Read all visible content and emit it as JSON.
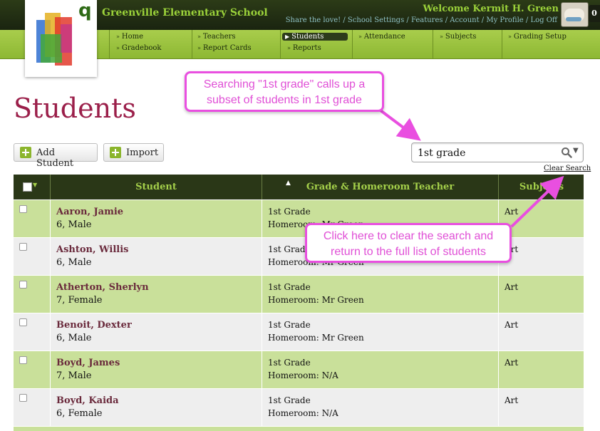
{
  "app": {
    "school_name": "Greenville Elementary School",
    "welcome": "Welcome Kermit H. Green",
    "avatar_badge": "0",
    "top_links": [
      "Share the love!",
      "School Settings",
      "Features",
      "Account",
      "My Profile",
      "Log Off"
    ],
    "logo_letter": "q"
  },
  "nav": {
    "col1": [
      "Home",
      "Gradebook"
    ],
    "col2": [
      "Teachers",
      "Report Cards"
    ],
    "col3": [
      "Students",
      "Reports"
    ],
    "col4": [
      "Attendance"
    ],
    "col5": [
      "Subjects"
    ],
    "col6": [
      "Grading Setup"
    ],
    "active": "Students"
  },
  "page": {
    "title": "Students",
    "add_student_label": "Add Student",
    "import_label": "Import",
    "search_value": "1st grade",
    "clear_search_label": "Clear Search"
  },
  "table": {
    "headers": [
      "Student",
      "Grade & Homeroom Teacher",
      "Subjects"
    ],
    "rows": [
      {
        "name": "Aaron, Jamie",
        "info": "6, Male",
        "grade": "1st Grade",
        "homeroom": "Homeroom: Mr Green",
        "subjects": "Art"
      },
      {
        "name": "Ashton, Willis",
        "info": "6, Male",
        "grade": "1st Grade",
        "homeroom": "Homeroom: Mr Green",
        "subjects": "Art"
      },
      {
        "name": "Atherton, Sherlyn",
        "info": "7, Female",
        "grade": "1st Grade",
        "homeroom": "Homeroom: Mr Green",
        "subjects": "Art"
      },
      {
        "name": "Benoit, Dexter",
        "info": "6, Male",
        "grade": "1st Grade",
        "homeroom": "Homeroom: Mr Green",
        "subjects": "Art"
      },
      {
        "name": "Boyd, James",
        "info": "7, Male",
        "grade": "1st Grade",
        "homeroom": "Homeroom: N/A",
        "subjects": "Art"
      },
      {
        "name": "Boyd, Kaida",
        "info": "6, Female",
        "grade": "1st Grade",
        "homeroom": "Homeroom: N/A",
        "subjects": "Art"
      }
    ]
  },
  "annotations": {
    "callout_search": "Searching \"1st grade\" calls up a subset of students in 1st grade",
    "callout_clear": "Click here to clear the search and return to the full list of students"
  },
  "colors": {
    "accent": "#9b1f4a",
    "nav_green": "#a9cd4c",
    "header_dark": "#2a3717",
    "row_green": "#c9e09a",
    "row_gray": "#eeeeee",
    "callout": "#e94fe0"
  },
  "icons": [
    "search-icon",
    "chevron-down-icon",
    "plus-icon",
    "sort-up-icon",
    "checkbox-icon",
    "nav-chevron-icon"
  ]
}
